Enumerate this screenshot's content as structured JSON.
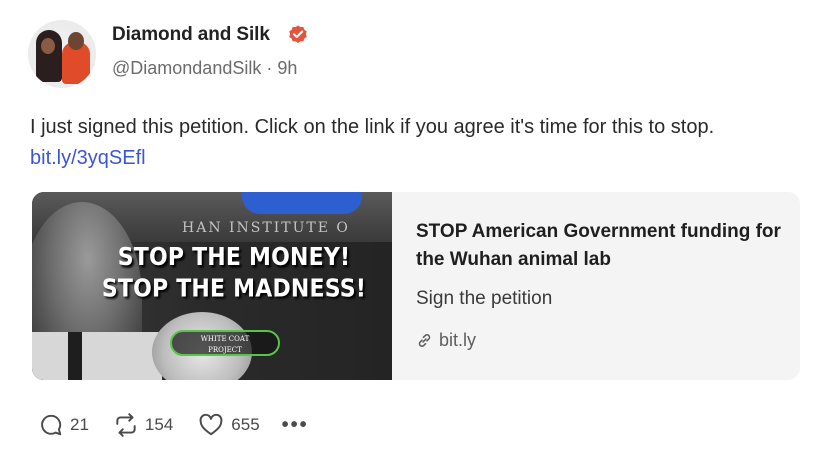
{
  "author": {
    "name": "Diamond and Silk",
    "handle_time": "@DiamondandSilk · 9h",
    "verified_color": "#e5533d"
  },
  "post": {
    "text": "I just signed this petition. Click on the link if you agree it's time for this to stop.",
    "link": "bit.ly/3yqSEfl"
  },
  "link_card": {
    "image_text_line1": "STOP THE MONEY!",
    "image_text_line2": "STOP THE MADNESS!",
    "image_building_text": "HAN INSTITUTE O",
    "image_badge_line1": "WHITE COAT",
    "image_badge_line2": "PROJECT",
    "title": "STOP American Government funding for the Wuhan animal lab",
    "subtitle": "Sign the petition",
    "domain": "bit.ly"
  },
  "actions": {
    "replies": "21",
    "reposts": "154",
    "likes": "655",
    "more": "•••"
  },
  "colors": {
    "link": "#3b55d6",
    "card_bg": "#f4f4f4",
    "badge_outline": "#57c44a"
  }
}
